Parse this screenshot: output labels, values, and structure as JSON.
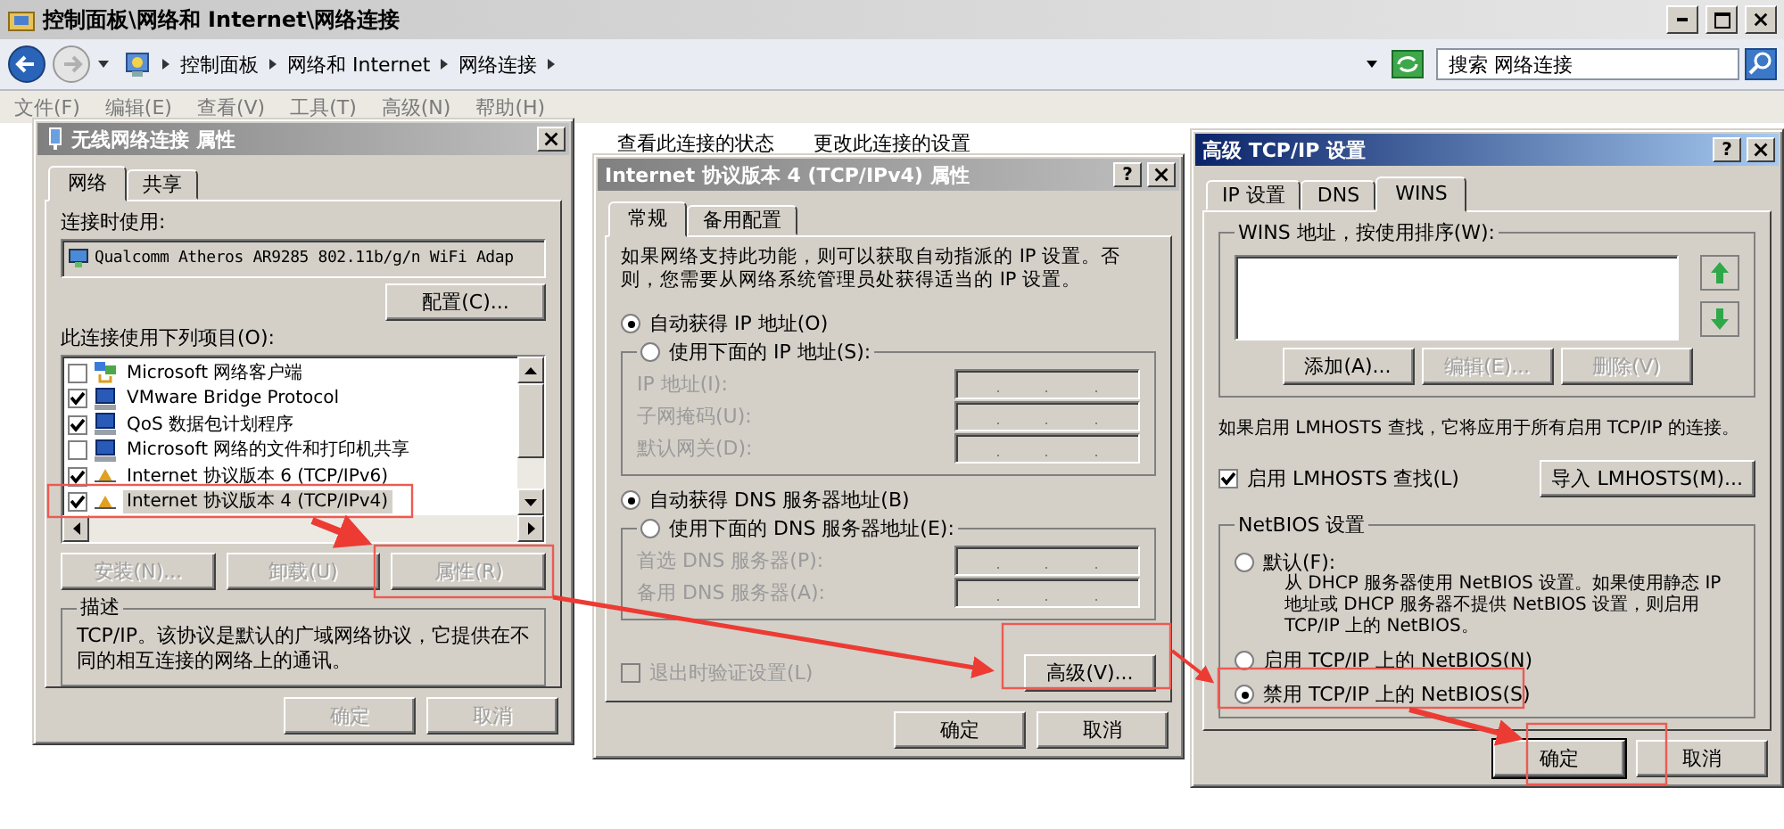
{
  "explorer": {
    "title": "控制面板\\网络和 Internet\\网络连接",
    "breadcrumb": [
      "控制面板",
      "网络和 Internet",
      "网络连接"
    ],
    "search_placeholder": "搜索 网络连接",
    "menu": [
      "文件(F)",
      "编辑(E)",
      "查看(V)",
      "工具(T)",
      "高级(N)",
      "帮助(H)"
    ],
    "toolbar": [
      "查看此连接的状态",
      "更改此连接的设置"
    ]
  },
  "adapter_dialog": {
    "title": "无线网络连接 属性",
    "tabs": [
      {
        "label": "网络",
        "selected": true
      },
      {
        "label": "共享",
        "selected": false
      }
    ],
    "connect_using_label": "连接时使用:",
    "adapter": "Qualcomm Atheros AR9285 802.11b/g/n WiFi Adap",
    "configure_button": "配置(C)...",
    "items_label": "此连接使用下列项目(O):",
    "items": [
      {
        "label": "Microsoft 网络客户端",
        "kind": "client",
        "checked": false,
        "selected": false
      },
      {
        "label": "VMware Bridge Protocol",
        "kind": "service",
        "checked": true,
        "selected": false
      },
      {
        "label": "QoS 数据包计划程序",
        "kind": "service",
        "checked": true,
        "selected": false
      },
      {
        "label": "Microsoft 网络的文件和打印机共享",
        "kind": "service",
        "checked": false,
        "selected": false
      },
      {
        "label": "Internet 协议版本 6 (TCP/IPv6)",
        "kind": "protocol",
        "checked": true,
        "selected": false
      },
      {
        "label": "Internet 协议版本 4 (TCP/IPv4)",
        "kind": "protocol",
        "checked": true,
        "selected": true
      }
    ],
    "item_buttons": [
      {
        "label": "安装(N)...",
        "disabled": true
      },
      {
        "label": "卸载(U)",
        "disabled": true
      },
      {
        "label": "属性(R)",
        "disabled": true
      }
    ],
    "description_title": "描述",
    "description": "TCP/IP。该协议是默认的广域网络协议，它提供在不同的相互连接的网络上的通讯。",
    "buttons": [
      {
        "label": "确定",
        "disabled": true
      },
      {
        "label": "取消",
        "disabled": true
      }
    ]
  },
  "ipv4_dialog": {
    "title": "Internet 协议版本 4 (TCP/IPv4) 属性",
    "help_button": "?",
    "tabs": [
      {
        "label": "常规",
        "selected": true
      },
      {
        "label": "备用配置",
        "selected": false
      }
    ],
    "intro": "如果网络支持此功能，则可以获取自动指派的 IP 设置。否则，您需要从网络系统管理员处获得适当的 IP 设置。",
    "ip_options": [
      {
        "label": "自动获得 IP 地址(O)",
        "selected": true
      },
      {
        "label": "使用下面的 IP 地址(S):",
        "selected": false
      }
    ],
    "ip_fields": [
      {
        "label": "IP 地址(I):",
        "disabled": true
      },
      {
        "label": "子网掩码(U):",
        "disabled": true
      },
      {
        "label": "默认网关(D):",
        "disabled": true
      }
    ],
    "dns_options": [
      {
        "label": "自动获得 DNS 服务器地址(B)",
        "selected": true
      },
      {
        "label": "使用下面的 DNS 服务器地址(E):",
        "selected": false
      }
    ],
    "dns_fields": [
      {
        "label": "首选 DNS 服务器(P):",
        "disabled": true
      },
      {
        "label": "备用 DNS 服务器(A):",
        "disabled": true
      }
    ],
    "validate_checkbox": {
      "label": "退出时验证设置(L)",
      "checked": false,
      "disabled": true
    },
    "advanced_button": "高级(V)...",
    "buttons": [
      {
        "label": "确定",
        "disabled": false
      },
      {
        "label": "取消",
        "disabled": false
      }
    ]
  },
  "advanced_dialog": {
    "title": "高级 TCP/IP 设置",
    "help_button": "?",
    "tabs": [
      {
        "label": "IP 设置",
        "selected": false
      },
      {
        "label": "DNS",
        "selected": false
      },
      {
        "label": "WINS",
        "selected": true
      }
    ],
    "wins_label": "WINS 地址，按使用排序(W):",
    "wins_buttons": [
      {
        "label": "添加(A)...",
        "disabled": false
      },
      {
        "label": "编辑(E)...",
        "disabled": true
      },
      {
        "label": "删除(V)",
        "disabled": true
      }
    ],
    "lmhosts_note": "如果启用 LMHOSTS 查找，它将应用于所有启用 TCP/IP 的连接。",
    "lmhosts_checkbox": {
      "label": "启用 LMHOSTS 查找(L)",
      "checked": true
    },
    "import_button": "导入 LMHOSTS(M)...",
    "netbios_label": "NetBIOS 设置",
    "netbios_options": [
      {
        "label": "默认(F):",
        "selected": false,
        "description": "从 DHCP 服务器使用 NetBIOS 设置。如果使用静态 IP 地址或 DHCP 服务器不提供 NetBIOS 设置，则启用 TCP/IP 上的 NetBIOS。"
      },
      {
        "label": "启用 TCP/IP 上的 NetBIOS(N)",
        "selected": false
      },
      {
        "label": "禁用 TCP/IP 上的 NetBIOS(S)",
        "selected": true
      }
    ],
    "buttons": [
      {
        "label": "确定",
        "disabled": false
      },
      {
        "label": "取消",
        "disabled": false
      }
    ]
  }
}
